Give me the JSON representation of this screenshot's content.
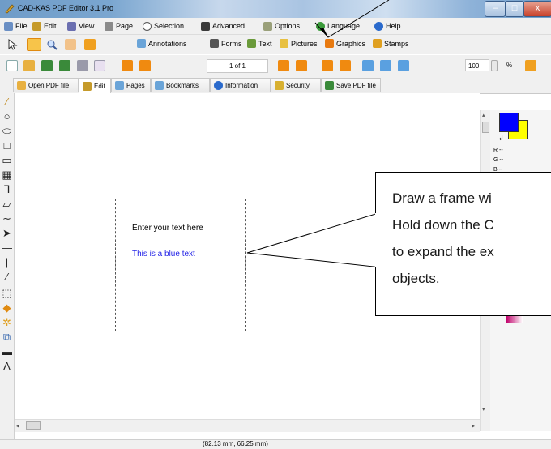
{
  "window": {
    "title": "CAD-KAS PDF Editor 3.1 Pro",
    "controls": [
      "–",
      "☐",
      "x"
    ]
  },
  "menu": [
    {
      "label": "File",
      "icon": "file-icon"
    },
    {
      "label": "Edit",
      "icon": "edit-icon"
    },
    {
      "label": "View",
      "icon": "view-icon"
    },
    {
      "label": "Page",
      "icon": "page-icon"
    },
    {
      "label": "Selection",
      "icon": "selection-icon"
    },
    {
      "label": "Advanced",
      "icon": "advanced-icon"
    },
    {
      "label": "Options",
      "icon": "options-icon"
    },
    {
      "label": "Language",
      "icon": "language-icon"
    },
    {
      "label": "Help",
      "icon": "help-icon"
    }
  ],
  "toolbar1": {
    "labels": [
      "Annotations",
      "Forms",
      "Text",
      "Pictures",
      "Graphics",
      "Stamps"
    ]
  },
  "toolbar2": {
    "page_field": "1 of 1",
    "zoom_value": "100",
    "zoom_unit": "%"
  },
  "tabs": [
    "Open PDF file",
    "Edit",
    "Pages",
    "Bookmarks",
    "Information",
    "Security",
    "Save PDF file"
  ],
  "right_panel": {
    "r_label": "R --",
    "g_label": "G --",
    "b_label": "B --"
  },
  "colors": {
    "foreground": "#0000ff",
    "background": "#ffff00",
    "text_blue": "#1f1fe6"
  },
  "canvas": {
    "text_line1": "Enter your text here",
    "text_line2": "This is a blue text"
  },
  "callout": {
    "lines": [
      "Draw a frame wi",
      "Hold down the C",
      "to expand the ex",
      "objects."
    ]
  },
  "statusbar": {
    "coords": "(82.13 mm, 66.25 mm)"
  }
}
